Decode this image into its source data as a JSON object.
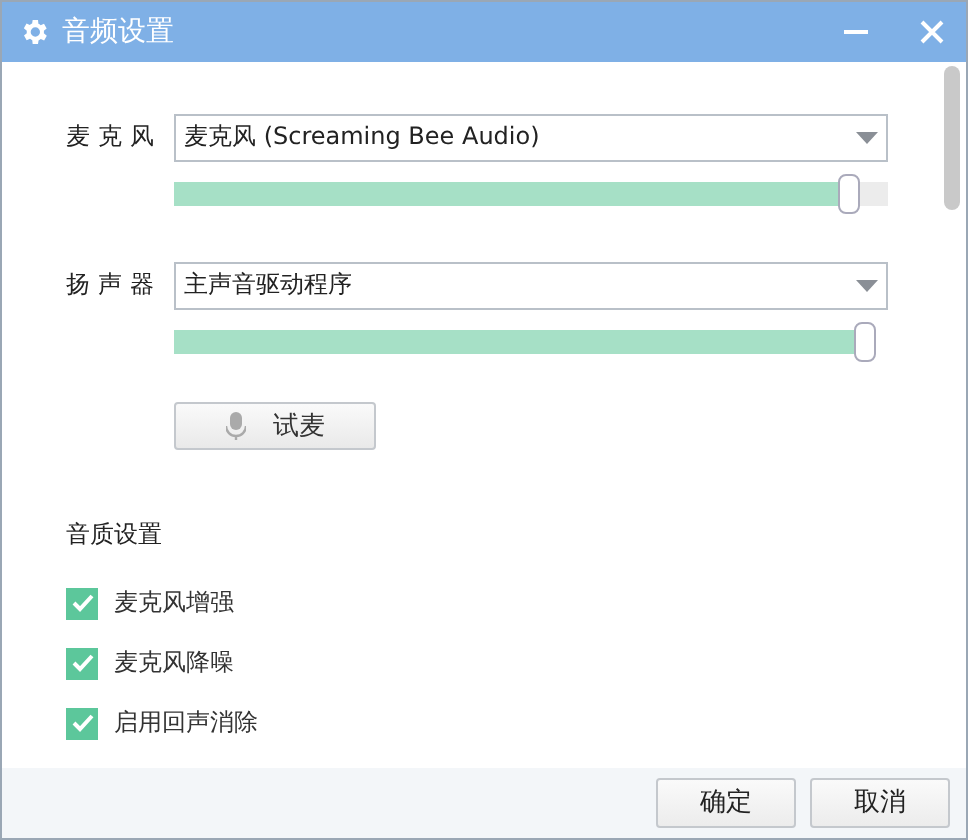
{
  "window": {
    "title": "音频设置"
  },
  "devices": [
    {
      "label": "麦克风",
      "value": "麦克风 (Screaming Bee Audio)",
      "level": 0.96
    },
    {
      "label": "扬声器",
      "value": "主声音驱动程序",
      "level": 1
    }
  ],
  "test_button": {
    "label": "试麦"
  },
  "quality": {
    "heading": "音质设置",
    "options": [
      {
        "label": "麦克风增强",
        "checked": true
      },
      {
        "label": "麦克风降噪",
        "checked": true
      },
      {
        "label": "启用回声消除",
        "checked": true
      }
    ]
  },
  "buttons": [
    "确定",
    "取消"
  ]
}
